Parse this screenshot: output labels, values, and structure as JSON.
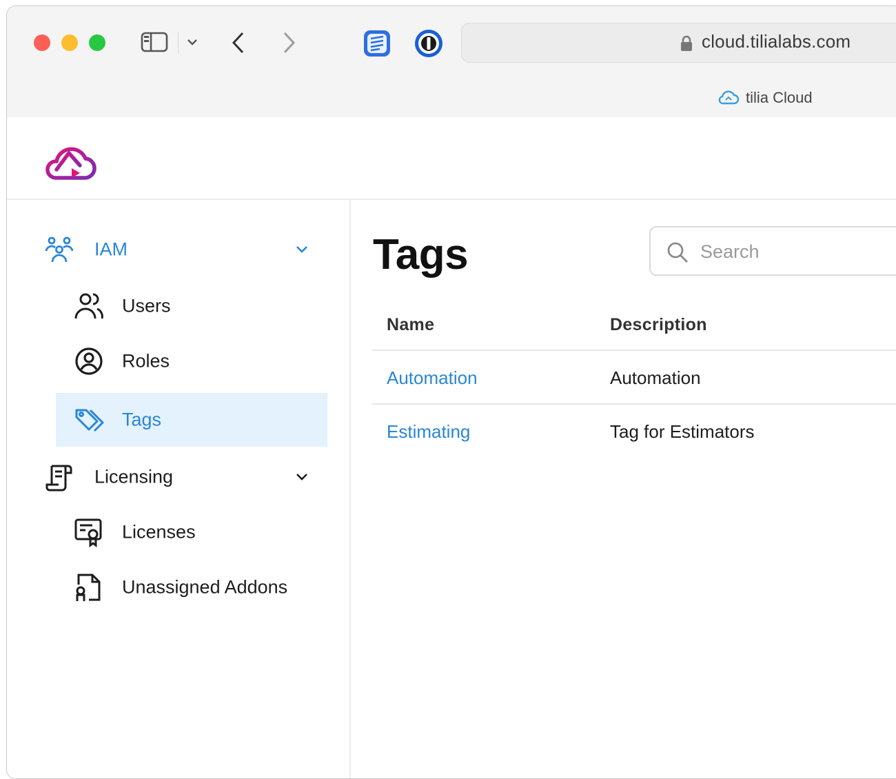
{
  "browser": {
    "url": "cloud.tilialabs.com",
    "tab_title": "tilia Cloud",
    "icons": [
      "sidebar-toggle-icon",
      "chevron-down-icon",
      "back-icon",
      "forward-icon",
      "notes-extension-icon",
      "password-manager-icon",
      "lock-icon",
      "cloud-icon"
    ]
  },
  "app": {
    "logo_icon": "tilia-cloud-logo",
    "accent_color": "#2a86d6",
    "active_bg": "#e3f2fc"
  },
  "sidebar": {
    "groups": [
      {
        "label": "IAM",
        "icon": "people-icon",
        "expanded": true,
        "items": [
          {
            "label": "Users",
            "icon": "users-icon"
          },
          {
            "label": "Roles",
            "icon": "role-badge-icon"
          },
          {
            "label": "Tags",
            "icon": "tags-icon",
            "active": true
          }
        ]
      },
      {
        "label": "Licensing",
        "icon": "license-scroll-icon",
        "expanded": true,
        "items": [
          {
            "label": "Licenses",
            "icon": "certificate-icon"
          },
          {
            "label": "Unassigned Addons",
            "icon": "addon-icon"
          }
        ]
      }
    ]
  },
  "main": {
    "title": "Tags",
    "search": {
      "placeholder": "Search",
      "value": ""
    },
    "table": {
      "columns": [
        "Name",
        "Description"
      ],
      "rows": [
        {
          "name": "Automation",
          "description": "Automation"
        },
        {
          "name": "Estimating",
          "description": "Tag for Estimators"
        }
      ]
    }
  }
}
